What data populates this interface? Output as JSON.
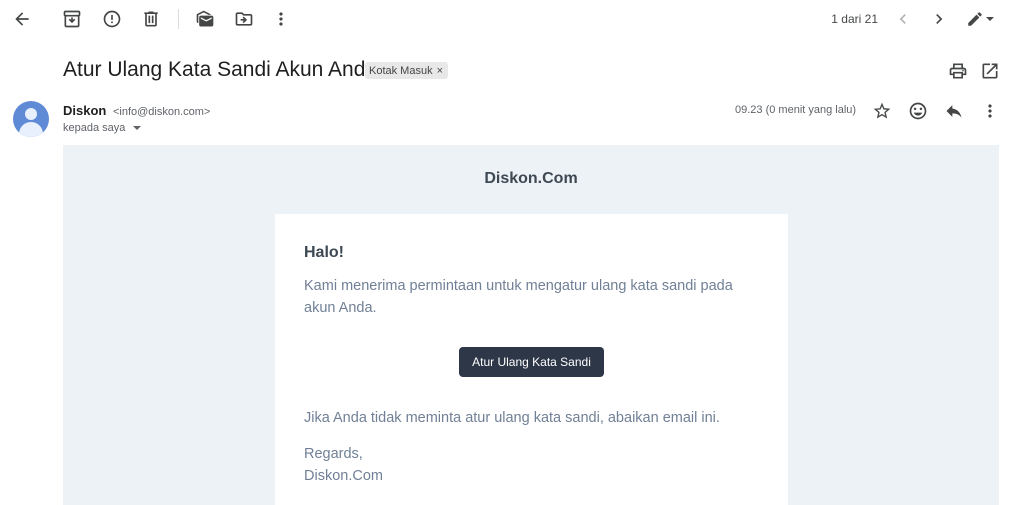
{
  "toolbar": {
    "back": "back-icon",
    "archive": "archive-icon",
    "report_spam": "report-spam-icon",
    "delete": "delete-icon",
    "mark_unread": "mark-unread-icon",
    "move_to": "move-to-icon",
    "more": "more-vert-icon"
  },
  "pager": {
    "text": "1 dari 21"
  },
  "email": {
    "subject": "Atur Ulang Kata Sandi Akun Anda",
    "label": "Kotak Masuk",
    "label_remove": "×",
    "sender_name": "Diskon",
    "sender_email": "<info@diskon.com>",
    "to_text": "kepada saya",
    "timestamp": "09.23 (0 menit yang lalu)"
  },
  "body": {
    "brand": "Diskon.Com",
    "greeting": "Halo!",
    "paragraph1": "Kami menerima permintaan untuk mengatur ulang kata sandi pada akun Anda.",
    "button_label": "Atur Ulang Kata Sandi",
    "paragraph2": "Jika Anda tidak meminta atur ulang kata sandi, abaikan email ini.",
    "signoff": "Regards,",
    "signature": "Diskon.Com"
  },
  "colors": {
    "email_bg": "#edf2f7",
    "button_bg": "#2d3748",
    "text_muted": "#718096",
    "heading": "#3d4852"
  }
}
